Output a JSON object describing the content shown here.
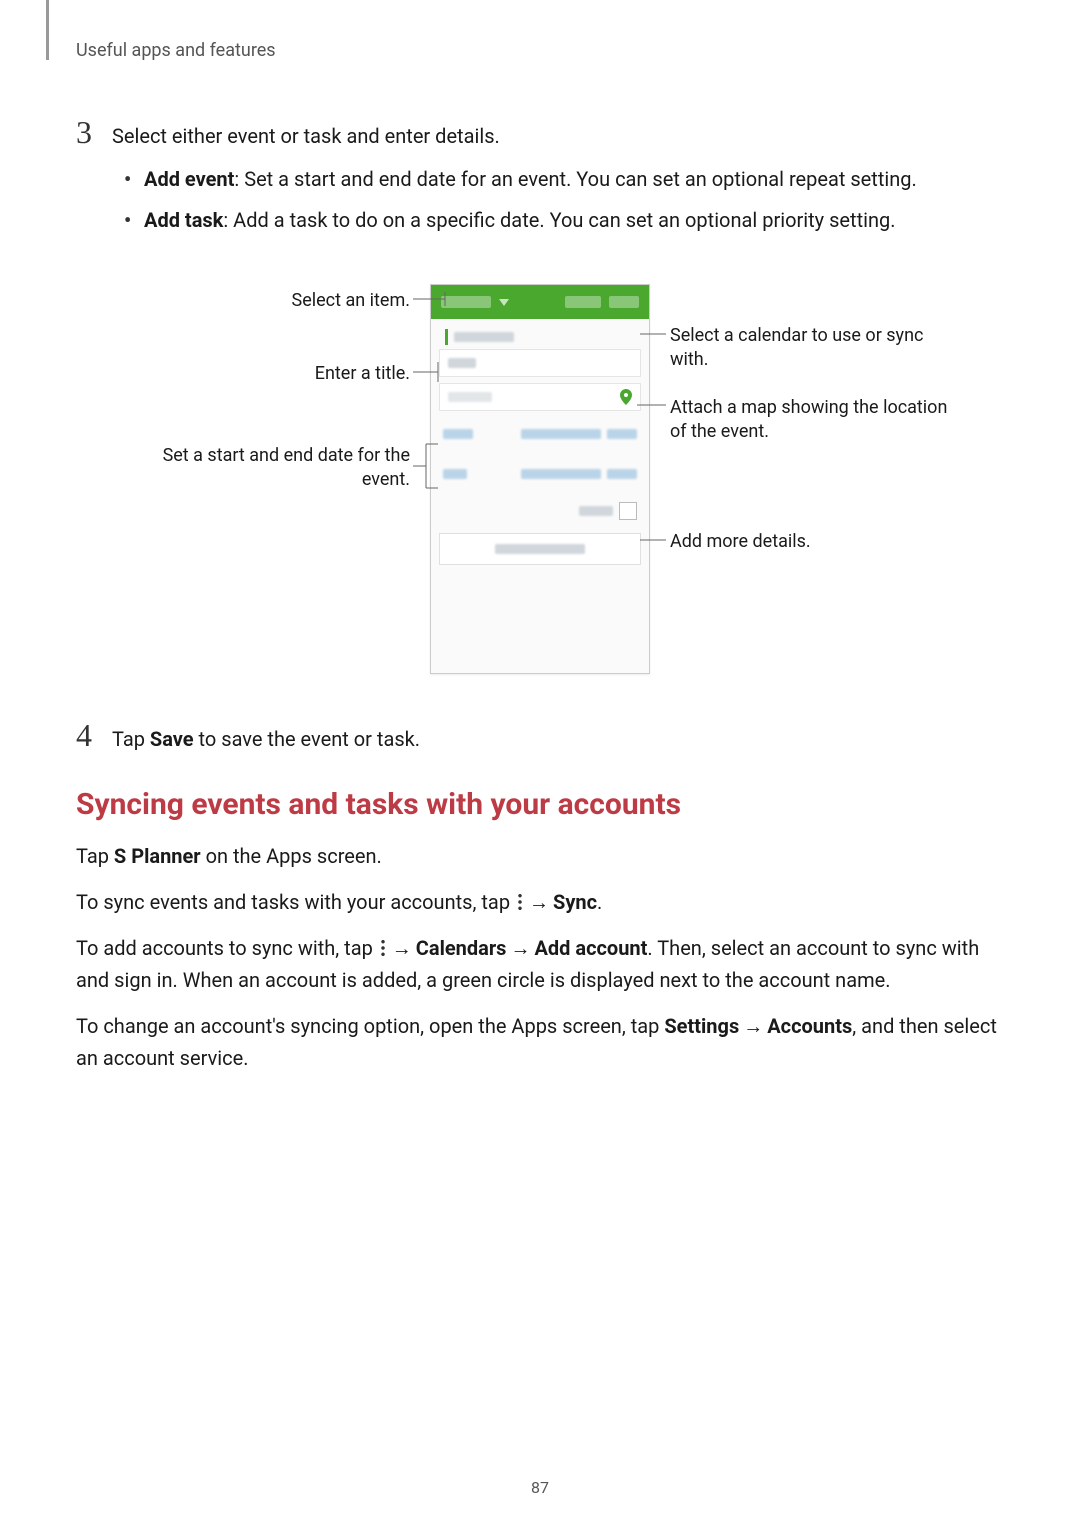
{
  "header": {
    "section": "Useful apps and features"
  },
  "step3": {
    "num": "3",
    "text": "Select either event or task and enter details.",
    "bullets": [
      {
        "title": "Add event",
        "desc": ": Set a start and end date for an event. You can set an optional repeat setting."
      },
      {
        "title": "Add task",
        "desc": ": Add a task to do on a specific date. You can set an optional priority setting."
      }
    ]
  },
  "callouts": {
    "selectItem": "Select an item.",
    "enterTitle": "Enter a title.",
    "setDates": "Set a start and end date for the event.",
    "selectCalendar": "Select a calendar to use or sync with.",
    "attachMap": "Attach a map showing the location of the event.",
    "addDetails": "Add more details."
  },
  "step4": {
    "num": "4",
    "pre": "Tap ",
    "bold": "Save",
    "post": " to save the event or task."
  },
  "h2": "Syncing events and tasks with your accounts",
  "p1": {
    "pre": "Tap ",
    "bold": "S Planner",
    "post": " on the Apps screen."
  },
  "p2": {
    "pre": "To sync events and tasks with your accounts, tap ",
    "arrow": " → ",
    "bold": "Sync",
    "post": "."
  },
  "p3": {
    "pre": "To add accounts to sync with, tap ",
    "arrow1": " → ",
    "b1": "Calendars",
    "arrow2": " → ",
    "b2": "Add account",
    "post": ". Then, select an account to sync with and sign in. When an account is added, a green circle is displayed next to the account name."
  },
  "p4": {
    "pre": "To change an account's syncing option, open the Apps screen, tap ",
    "b1": "Settings",
    "arrow": " → ",
    "b2": "Accounts",
    "post": ", and then select an account service."
  },
  "pageNum": "87"
}
